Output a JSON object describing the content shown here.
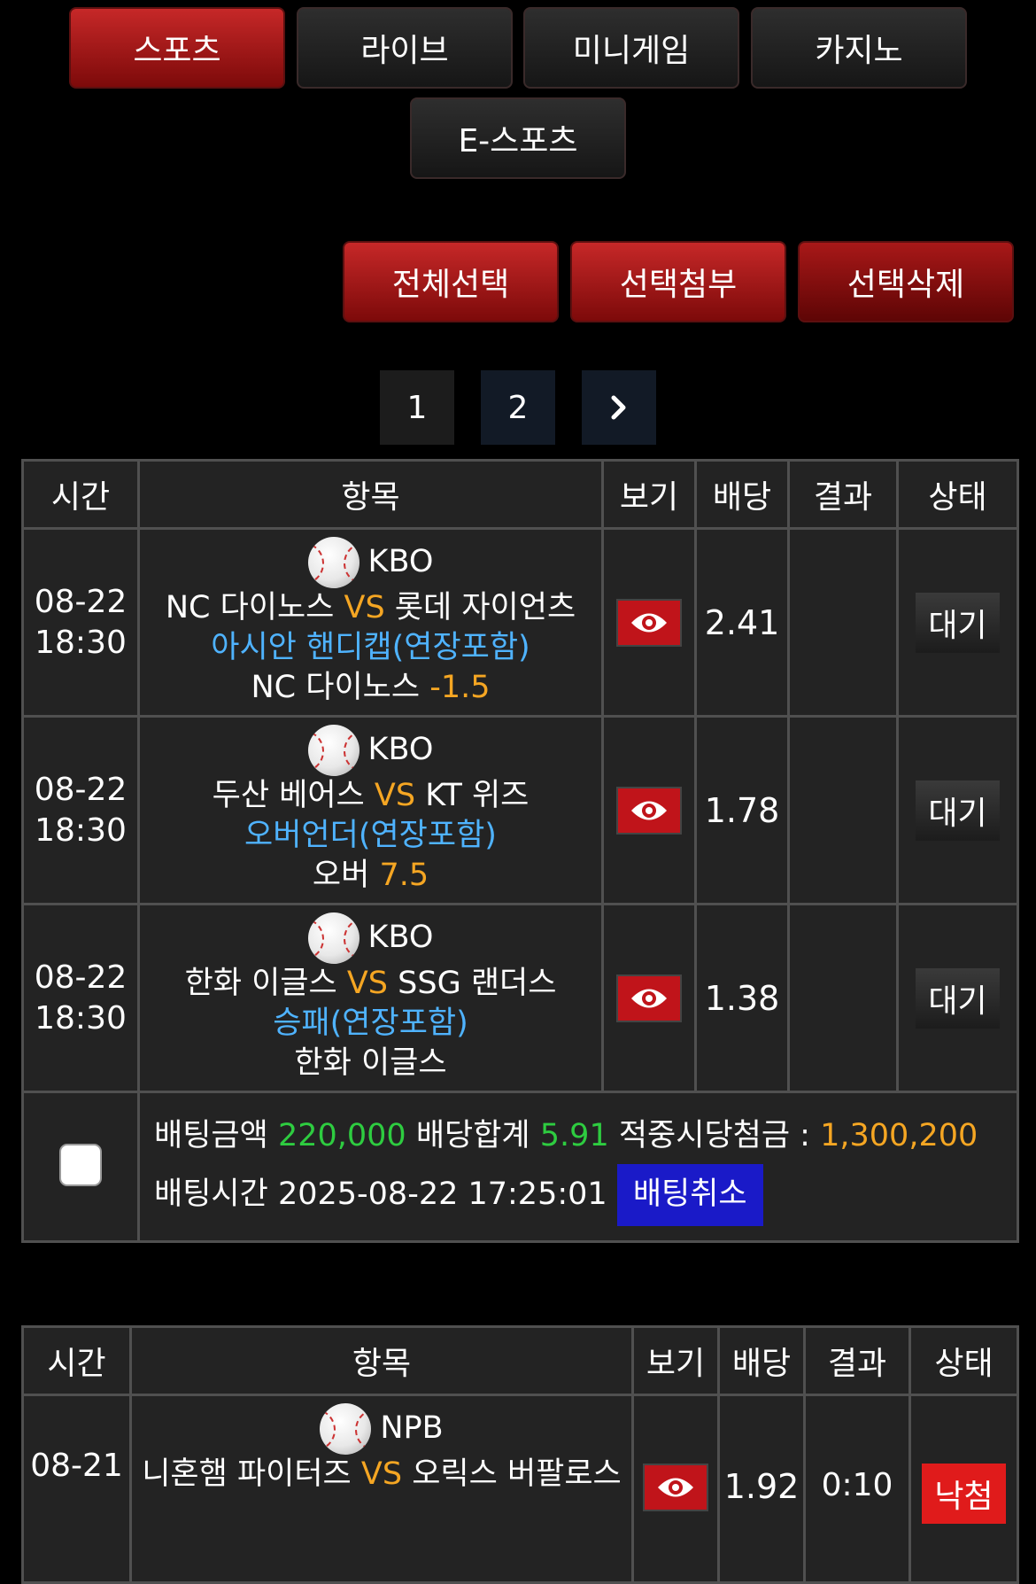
{
  "nav": {
    "tabs": [
      "스포츠",
      "라이브",
      "미니게임",
      "카지노",
      "E-스포츠"
    ]
  },
  "actions": {
    "select_all": "전체선택",
    "attach_selected": "선택첨부",
    "delete_selected": "선택삭제"
  },
  "pagination": {
    "pages": [
      "1",
      "2"
    ],
    "next": "›"
  },
  "table_headers": {
    "time": "시간",
    "item": "항목",
    "view": "보기",
    "odds": "배당",
    "result": "결과",
    "status": "상태"
  },
  "slip1": {
    "rows": [
      {
        "date": "08-22",
        "time": "18:30",
        "league": "KBO",
        "home": "NC 다이노스",
        "vs": "VS",
        "away": "롯데 자이언츠",
        "market": "아시안 핸디캡(연장포함)",
        "pick": "NC 다이노스",
        "line": "-1.5",
        "odds": "2.41",
        "result": "",
        "status": "대기"
      },
      {
        "date": "08-22",
        "time": "18:30",
        "league": "KBO",
        "home": "두산 베어스",
        "vs": "VS",
        "away": "KT 위즈",
        "market": "오버언더(연장포함)",
        "pick": "오버",
        "line": "7.5",
        "odds": "1.78",
        "result": "",
        "status": "대기"
      },
      {
        "date": "08-22",
        "time": "18:30",
        "league": "KBO",
        "home": "한화 이글스",
        "vs": "VS",
        "away": "SSG 랜더스",
        "market": "승패(연장포함)",
        "pick": "한화 이글스",
        "line": "",
        "odds": "1.38",
        "result": "",
        "status": "대기"
      }
    ],
    "summary": {
      "bet_amount_label": "배팅금액",
      "bet_amount": "220,000",
      "odds_total_label": "배당합계",
      "odds_total": "5.91",
      "payout_label": "적중시당첨금 :",
      "payout": "1,300,200",
      "bet_time_label": "배팅시간",
      "bet_time": "2025-08-22 17:25:01",
      "cancel_label": "배팅취소"
    }
  },
  "slip2": {
    "rows": [
      {
        "date": "08-21",
        "league": "NPB",
        "home": "니혼햄 파이터즈",
        "vs": "VS",
        "away": "오릭스 버팔로스",
        "odds": "1.92",
        "result": "0:10",
        "status": "낙첨"
      }
    ]
  },
  "colors": {
    "accent_red": "#c62828",
    "odds_green": "#2ecc40",
    "vs_orange": "#f5a623",
    "market_blue": "#4fb3ff",
    "cancel_blue": "#1a1ac8"
  }
}
